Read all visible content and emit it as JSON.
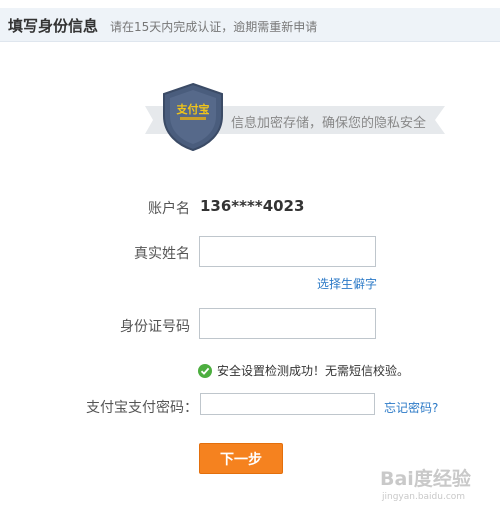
{
  "header": {
    "title": "填写身份信息",
    "subtitle": "请在15天内完成认证，逾期需重新申请"
  },
  "banner": {
    "text": "信息加密存储，确保您的隐私安全",
    "shield_logo_text": "支付宝"
  },
  "form": {
    "account_label": "账户名",
    "account_value": "136****4023",
    "realname_label": "真实姓名",
    "realname_value": "",
    "rare_char_link": "选择生僻字",
    "idcard_label": "身份证号码",
    "idcard_value": "",
    "security_status": "安全设置检测成功！无需短信校验。",
    "paypwd_label": "支付宝支付密码：",
    "paypwd_value": "",
    "forgot_link": "忘记密码?",
    "next_button": "下一步"
  },
  "watermark": {
    "brand": "Bai度经验",
    "url": "jingyan.baidu.com"
  },
  "colors": {
    "header_bg": "#eef3f8",
    "link": "#2c7ac7",
    "button": "#f5821f",
    "success": "#4cae3f",
    "shield": "#4a5d7d"
  }
}
